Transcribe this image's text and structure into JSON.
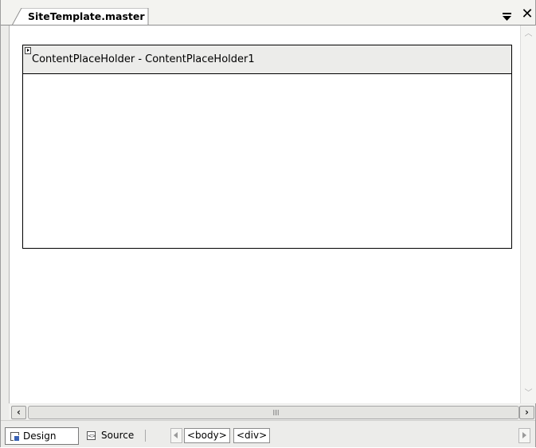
{
  "document_tab": {
    "title": "SiteTemplate.master",
    "window_position_icon": "window-position-dropdown-icon",
    "close_icon": "close-icon"
  },
  "design_surface": {
    "content_placeholder_label": "ContentPlaceHolder - ContentPlaceHolder1",
    "smart_tag_icon": "smart-tag-arrow-icon"
  },
  "view_bar": {
    "design_label": "Design",
    "source_label": "Source",
    "selected_view": "Design"
  },
  "tag_navigator": {
    "crumbs": [
      "<body>",
      "<div>"
    ]
  },
  "colors": {
    "chrome": "#ececea",
    "surface": "#ffffff",
    "border": "#000000"
  }
}
